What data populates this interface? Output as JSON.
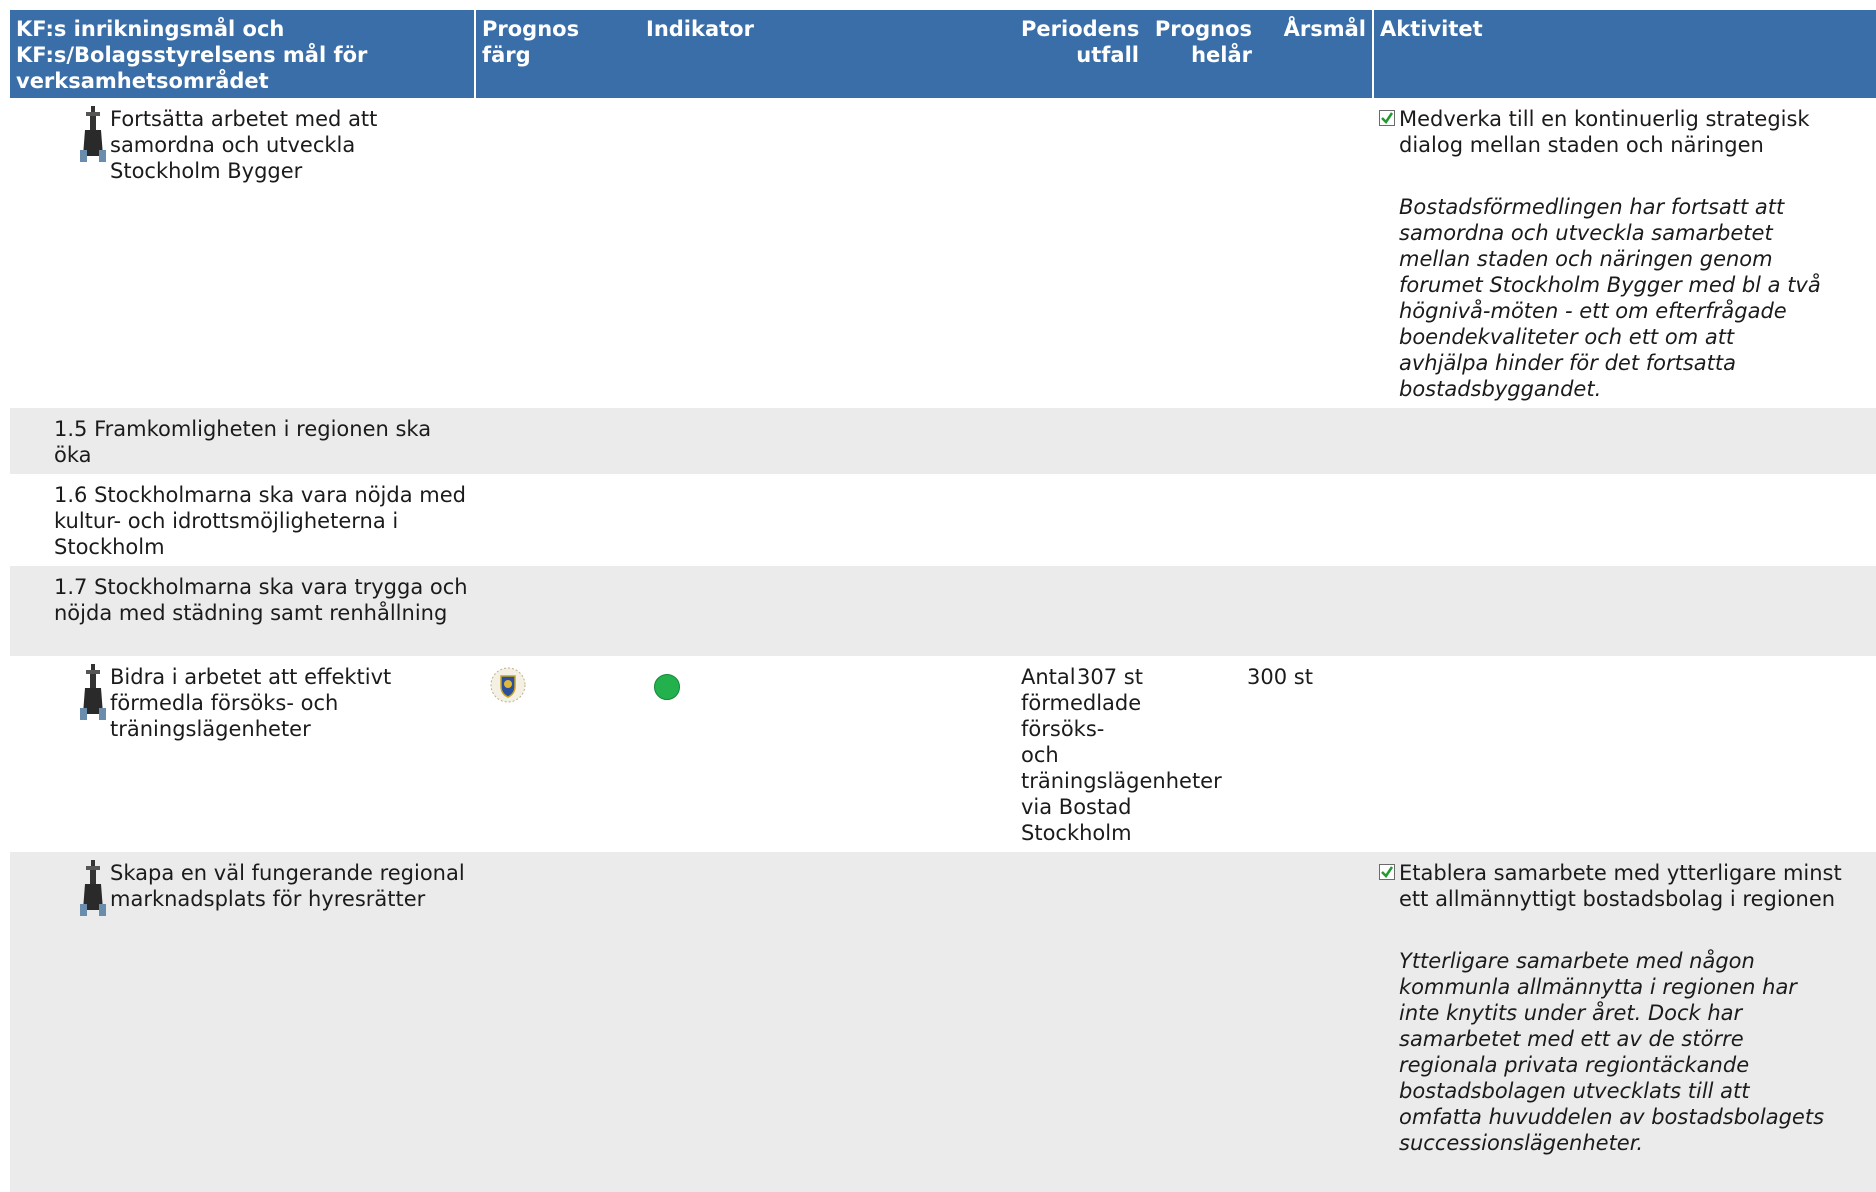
{
  "header": {
    "col_goal": "KF:s inrikningsmål och KF:s/Bolagsstyrelsens mål för verksamhetsområdet",
    "col_forecast_color": "Prognos färg",
    "col_indicator": "Indikator",
    "col_period_outcome": "Periodens utfall",
    "col_forecast_year": "Prognos helår",
    "col_year_target": "Årsmål",
    "col_activity": "Aktivitet"
  },
  "rows": [
    {
      "goal": "Fortsätta arbetet med att samordna och utveckla Stockholm Bygger",
      "activity_title": "Medverka till en kontinuerlig strategisk dialog mellan staden och näringen",
      "activity_desc": "Bostadsförmedlingen har fortsatt att\nsamordna och utveckla samarbetet\nmellan staden och näringen genom\nforumet Stockholm Bygger med bl a två\nhögnivå-möten - ett om efterfrågade\nboendekvaliteter och ett om att\navhjälpa hinder för det fortsatta\nbostadsbyggandet."
    },
    {
      "goal": "1.5 Framkomligheten i regionen ska öka"
    },
    {
      "goal": "1.6 Stockholmarna ska vara nöjda med kultur- och idrottsmöjligheterna i Stockholm"
    },
    {
      "goal": "1.7 Stockholmarna ska vara trygga och nöjda med städning samt renhållning"
    },
    {
      "goal": "Bidra i arbetet att effektivt förmedla försöks- och träningslägenheter",
      "indicator": "Antal förmedlade försöks- och träningslägenheter via Bostad Stockholm",
      "period_outcome": "307 st",
      "year_target": "300 st",
      "forecast_status_color": "#22b14c"
    },
    {
      "goal": "Skapa en väl fungerande regional marknadsplats för hyresrätter",
      "activity_title": "Etablera samarbete med ytterligare minst ett allmännyttigt bostadsbolag i regionen",
      "activity_desc": "Ytterligare samarbete med någon\nkommunla allmännytta i regionen har\ninte knytits under året. Dock har\nsamarbetet med ett av de större\nregionala privata regiontäckande\nbostadsbolagen utvecklats till att\nomfatta huvuddelen av bostadsbolagets\nsuccessionslägenheter."
    }
  ],
  "colors": {
    "header_bg": "#3a6ea8",
    "alt_row_bg": "#ebebeb",
    "status_green": "#22b14c"
  }
}
